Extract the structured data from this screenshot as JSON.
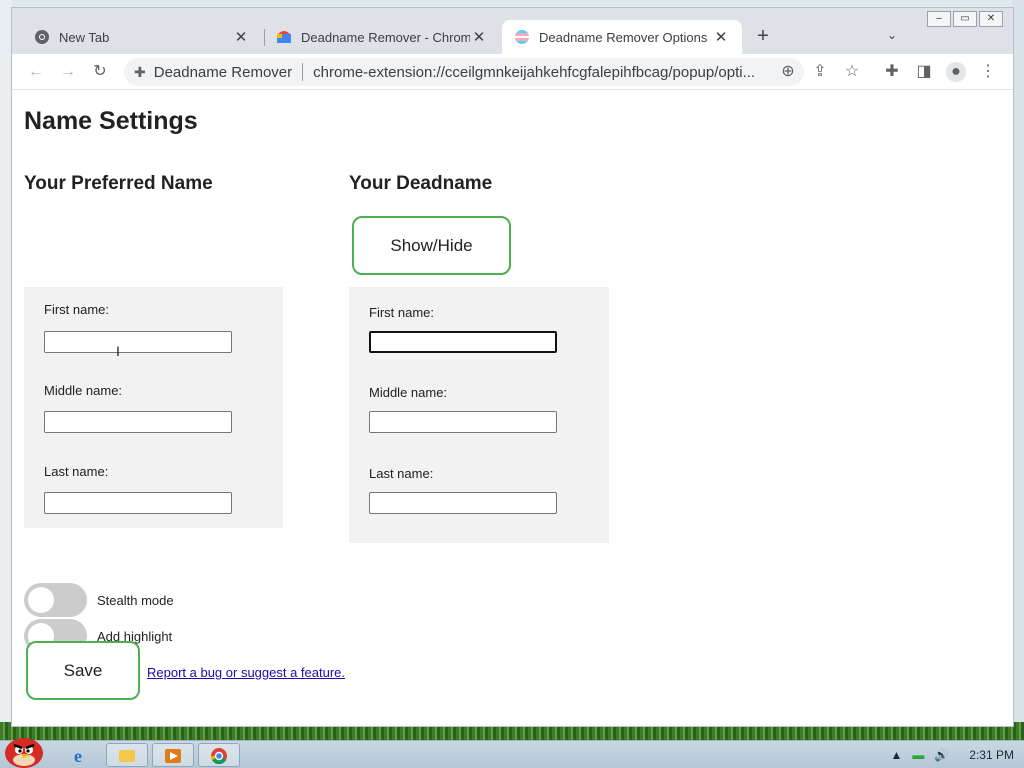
{
  "browser": {
    "tabs": [
      {
        "title": "New Tab",
        "icon": "chrome-icon"
      },
      {
        "title": "Deadname Remover - Chrome",
        "icon": "web-store-icon"
      },
      {
        "title": "Deadname Remover Options",
        "icon": "trans-flag-icon",
        "active": true
      }
    ],
    "omnibox": {
      "extension_name": "Deadname Remover",
      "url": "chrome-extension://cceilgmnkeijahkehfcgfalepihfbcag/popup/opti..."
    },
    "window_controls": {
      "minimize": "–",
      "restore": "▭",
      "close": "✕"
    }
  },
  "page": {
    "title": "Name Settings",
    "preferred": {
      "heading": "Your Preferred Name",
      "first_label": "First name:",
      "middle_label": "Middle name:",
      "last_label": "Last name:",
      "first_value": "",
      "middle_value": "",
      "last_value": ""
    },
    "deadname": {
      "heading": "Your Deadname",
      "show_hide_label": "Show/Hide",
      "first_label": "First name:",
      "middle_label": "Middle name:",
      "last_label": "Last name:",
      "first_value": "",
      "middle_value": "",
      "last_value": ""
    },
    "toggles": {
      "stealth_label": "Stealth mode",
      "stealth_on": false,
      "highlight_label": "Add highlight",
      "highlight_on": false
    },
    "save_label": "Save",
    "report_link": "Report a bug or suggest a feature."
  },
  "taskbar": {
    "clock": "2:31 PM",
    "tray_icons": [
      "show-hidden-icons-icon",
      "network-icon",
      "volume-icon"
    ]
  },
  "colors": {
    "accent_border": "#4caf50",
    "panel_bg": "#f2f2f2",
    "toggle_off": "#cccccc",
    "link": "#1a0dab"
  }
}
